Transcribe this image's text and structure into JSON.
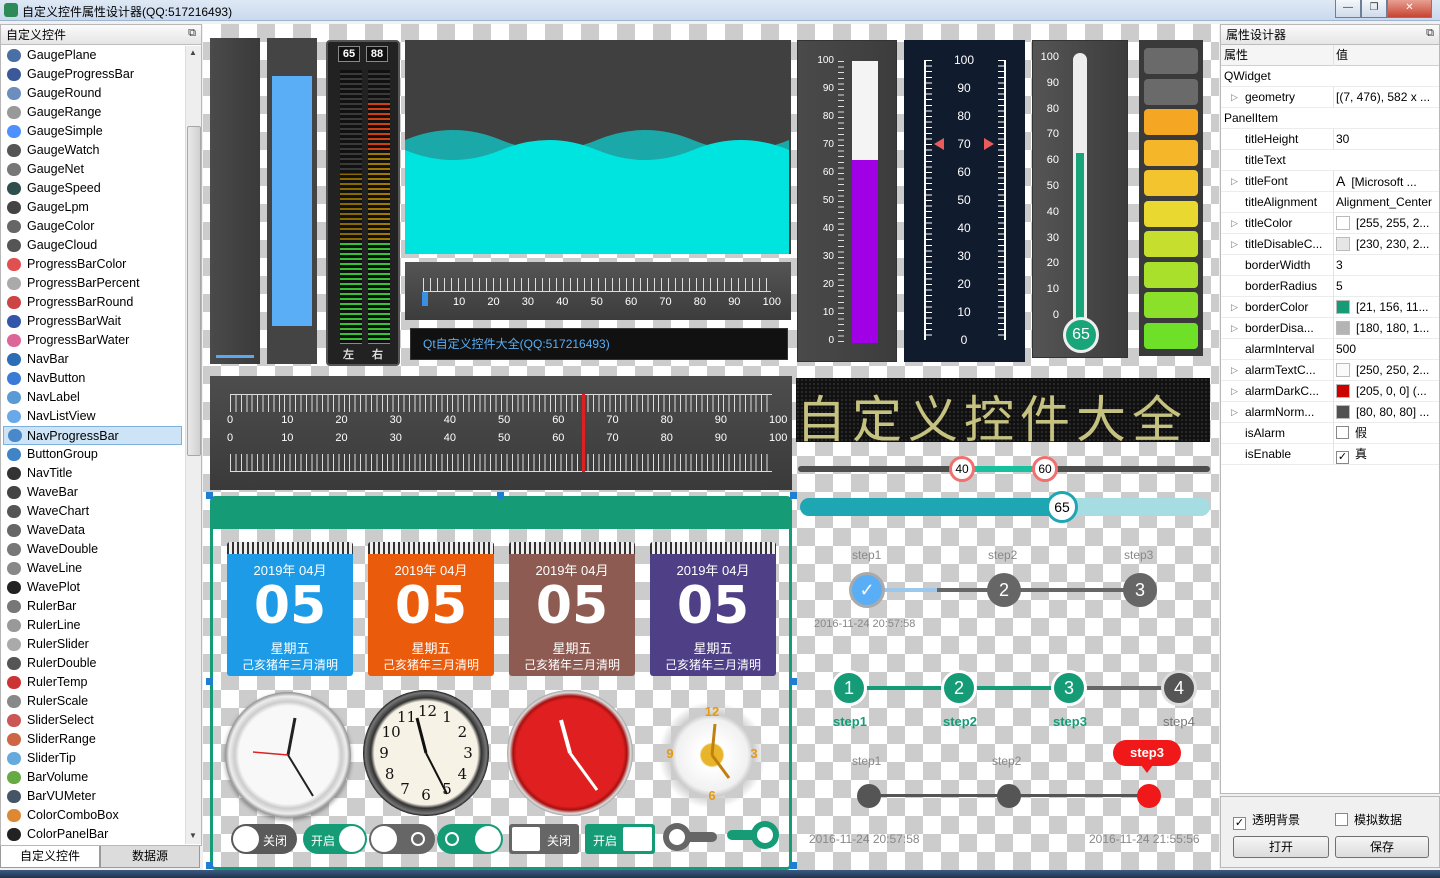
{
  "window": {
    "title": "自定义控件属性设计器(QQ:517216493)",
    "buttons": {
      "minimize": "—",
      "restore": "❐",
      "close": "✕"
    }
  },
  "left_dock": {
    "title": "自定义控件",
    "items": [
      "GaugePlane",
      "GaugeProgressBar",
      "GaugeRound",
      "GaugeRange",
      "GaugeSimple",
      "GaugeWatch",
      "GaugeNet",
      "GaugeSpeed",
      "GaugeLpm",
      "GaugeColor",
      "GaugeCloud",
      "ProgressBarColor",
      "ProgressBarPercent",
      "ProgressBarRound",
      "ProgressBarWait",
      "ProgressBarWater",
      "NavBar",
      "NavButton",
      "NavLabel",
      "NavListView",
      "NavProgressBar",
      "ButtonGroup",
      "NavTitle",
      "WaveBar",
      "WaveChart",
      "WaveData",
      "WaveDouble",
      "WaveLine",
      "WavePlot",
      "RulerBar",
      "RulerLine",
      "RulerSlider",
      "RulerDouble",
      "RulerTemp",
      "RulerScale",
      "SliderSelect",
      "SliderRange",
      "SliderTip",
      "BarVolume",
      "BarVUMeter",
      "ColorComboBox",
      "ColorPanelBar"
    ],
    "selected": "NavProgressBar",
    "icon_colors": [
      "#4a6fa5",
      "#3b5998",
      "#6c8ebf",
      "#999999",
      "#4d90fe",
      "#555555",
      "#777777",
      "#2f4f4f",
      "#444444",
      "#666666",
      "#555555",
      "#e05050",
      "#aaaaaa",
      "#cc4444",
      "#3355aa",
      "#dd6699",
      "#2c6db5",
      "#3a7bd5",
      "#5a9bd5",
      "#6aa9e9",
      "#4a89c9",
      "#3f84c6",
      "#333333",
      "#444444",
      "#555555",
      "#666666",
      "#777777",
      "#888888",
      "#222222",
      "#777777",
      "#999999",
      "#aaaaaa",
      "#555555",
      "#cc3333",
      "#888888",
      "#cc5555",
      "#cc6644",
      "#66aadd",
      "#66aa44",
      "#445566",
      "#dd8833",
      "#222222"
    ],
    "tabs": [
      "自定义控件",
      "数据源"
    ]
  },
  "right_dock": {
    "title": "属性设计器",
    "col_property": "属性",
    "col_value": "值",
    "rows": [
      {
        "type": "group",
        "name": "QWidget"
      },
      {
        "type": "prop",
        "name": "geometry",
        "value": "[(7, 476), 582 x ...",
        "expand": true
      },
      {
        "type": "group",
        "name": "PanelItem"
      },
      {
        "type": "prop",
        "name": "titleHeight",
        "value": "30"
      },
      {
        "type": "prop",
        "name": "titleText",
        "value": ""
      },
      {
        "type": "prop",
        "name": "titleFont",
        "value": "[Microsoft ...",
        "expand": true,
        "font_icon": "A"
      },
      {
        "type": "prop",
        "name": "titleAlignment",
        "value": "Alignment_Center"
      },
      {
        "type": "prop",
        "name": "titleColor",
        "value": "[255, 255, 2...",
        "expand": true,
        "swatch": "#ffffff"
      },
      {
        "type": "prop",
        "name": "titleDisableC...",
        "value": "[230, 230, 2...",
        "expand": true,
        "swatch": "#e6e6e6"
      },
      {
        "type": "prop",
        "name": "borderWidth",
        "value": "3"
      },
      {
        "type": "prop",
        "name": "borderRadius",
        "value": "5"
      },
      {
        "type": "prop",
        "name": "borderColor",
        "value": "[21, 156, 11...",
        "expand": true,
        "swatch": "#159c77"
      },
      {
        "type": "prop",
        "name": "borderDisa...",
        "value": "[180, 180, 1...",
        "expand": true,
        "swatch": "#b4b4b4"
      },
      {
        "type": "prop",
        "name": "alarmInterval",
        "value": "500"
      },
      {
        "type": "prop",
        "name": "alarmTextC...",
        "value": "[250, 250, 2...",
        "expand": true,
        "swatch": "#fafafa"
      },
      {
        "type": "prop",
        "name": "alarmDarkC...",
        "value": "[205, 0, 0] (...",
        "expand": true,
        "swatch": "#cd0000"
      },
      {
        "type": "prop",
        "name": "alarmNorm...",
        "value": "[80, 80, 80] ...",
        "expand": true,
        "swatch": "#505050"
      },
      {
        "type": "prop",
        "name": "isAlarm",
        "value": "假",
        "check": false
      },
      {
        "type": "prop",
        "name": "isEnable",
        "value": "真",
        "check": true
      }
    ],
    "opt_transparent": "透明背景",
    "opt_transparent_checked": true,
    "opt_simulate": "模拟数据",
    "opt_simulate_checked": false,
    "btn_open": "打开",
    "btn_save": "保存"
  },
  "canvas": {
    "vu_left_value": "65",
    "vu_right_value": "88",
    "vu_left_label": "左",
    "vu_right_label": "右",
    "ruler_ticks": [
      "10",
      "20",
      "30",
      "40",
      "50",
      "60",
      "70",
      "80",
      "90",
      "100"
    ],
    "ruler_value": 0,
    "panel_title": "Qt自定义控件大全(QQ:517216493)",
    "thermo_ticks": [
      "100",
      "90",
      "80",
      "70",
      "60",
      "50",
      "40",
      "30",
      "20",
      "10",
      "0"
    ],
    "thermo_value": 65,
    "ruler_slider_ticks": [
      "100",
      "90",
      "80",
      "70",
      "60",
      "50",
      "40",
      "30",
      "20",
      "10",
      "0"
    ],
    "ruler_slider_value": 70,
    "temp_ticks": [
      "100",
      "90",
      "80",
      "70",
      "60",
      "50",
      "40",
      "30",
      "20",
      "10",
      "0"
    ],
    "temp_value": "65",
    "double_ruler_ticks": [
      "0",
      "10",
      "20",
      "30",
      "40",
      "50",
      "60",
      "70",
      "80",
      "90",
      "100"
    ],
    "double_ruler_value": 65,
    "led_text": "自定义控件大全",
    "range_min": "40",
    "range_max": "60",
    "slider_value": "65",
    "calendars": [
      {
        "ym": "2019年 04月",
        "day": "05",
        "week": "星期五",
        "lunar": "己亥猪年三月清明",
        "color": "#1e9be6"
      },
      {
        "ym": "2019年 04月",
        "day": "05",
        "week": "星期五",
        "lunar": "己亥猪年三月清明",
        "color": "#ea5b0c"
      },
      {
        "ym": "2019年 04月",
        "day": "05",
        "week": "星期五",
        "lunar": "己亥猪年三月清明",
        "color": "#8e5b52"
      },
      {
        "ym": "2019年 04月",
        "day": "05",
        "week": "星期五",
        "lunar": "己亥猪年三月清明",
        "color": "#4e3f86"
      }
    ],
    "clock_numbers": [
      "12",
      "1",
      "2",
      "3",
      "4",
      "5",
      "6",
      "7",
      "8",
      "9",
      "10",
      "11"
    ],
    "flower_numbers": [
      "12",
      "3",
      "6",
      "9"
    ],
    "toggles": [
      {
        "label": "关闭"
      },
      {
        "label": "开启"
      },
      {
        "label": ""
      },
      {
        "label": ""
      },
      {
        "label": "关闭"
      },
      {
        "label": "开启"
      },
      {
        "label": ""
      },
      {
        "label": ""
      }
    ],
    "nav1": {
      "steps": [
        "step1",
        "step2",
        "step3"
      ],
      "check": "✓",
      "n2": "2",
      "n3": "3",
      "time": "2016-11-24 20:57:58"
    },
    "nav2": {
      "nums": [
        "1",
        "2",
        "3",
        "4"
      ],
      "labels": [
        "step1",
        "step2",
        "step3",
        "step4"
      ]
    },
    "nav3": {
      "labels": [
        "step1",
        "step2"
      ],
      "tip": "step3",
      "time_left": "2016-11-24 20:57:58",
      "time_right": "2016-11-24 21:55:56"
    }
  }
}
